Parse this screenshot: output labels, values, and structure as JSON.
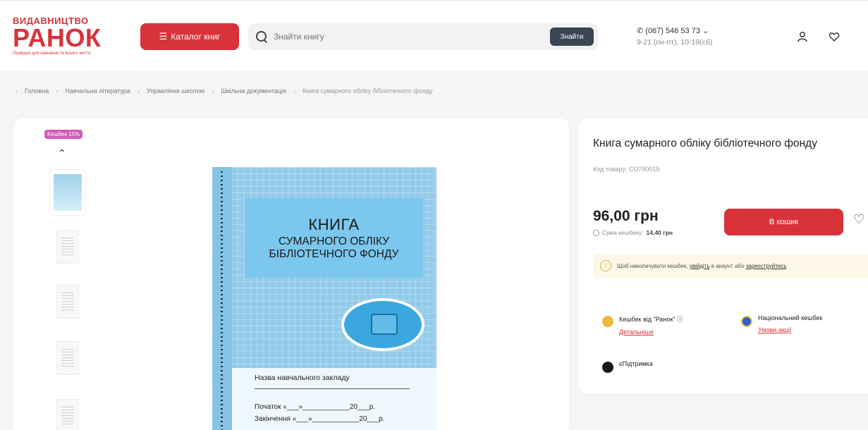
{
  "header": {
    "logo": {
      "top": "ВИДАВНИЦТВО",
      "main": "РАНОК",
      "sub": "Провідне для навчання та всього життя"
    },
    "catalog_label": "Каталог книг",
    "search": {
      "placeholder": "Знайти книгу",
      "button_label": "Знайти"
    },
    "phone": {
      "number": "(067) 546 53 73",
      "hours": "9-21 (пн-пт), 10-19(сб)"
    },
    "icons": [
      "user-icon",
      "heart-icon"
    ]
  },
  "breadcrumbs": [
    "Головна",
    "Навчальна література",
    "Управління школою",
    "Шкільна документація",
    "Книга сумарного обліку бібліотечного фонду"
  ],
  "gallery": {
    "badge": "Кешбек 15%",
    "cover": {
      "title1": "КНИГА",
      "title2": "СУМАРНОГО ОБЛІКУ",
      "title3": "БІБЛІОТЕЧНОГО ФОНДУ",
      "school_label": "Назва навчального закладу",
      "start_line": "Початок  «___»____________20___р.",
      "end_line": "Закінчення  «___»____________20___р."
    }
  },
  "product": {
    "name": "Книга сумарного обліку бібліотечного фонду",
    "code": "Код товару: СО780019",
    "price": "96,00 грн",
    "cashback_label": "Сума кешбеку:",
    "cashback_value": "14,40 грн",
    "buy_label": "В кошик",
    "notice_pre": "Щоб накопичувати кешбек, ",
    "notice_link1": "увійдіть",
    "notice_mid": " в акаунт або ",
    "notice_link2": "зареєструйтесь",
    "perks": [
      {
        "title": "Кешбек від \"Ранок\" ⓘ",
        "link": "Детальніше",
        "color": "#f2b83b"
      },
      {
        "title": "Національний кешбек",
        "link": "Умови акції",
        "color": "#2f5fd0"
      },
      {
        "title": "єПідтримка",
        "link": "",
        "color": "#1a1a1a"
      }
    ]
  },
  "colors": {
    "brand": "#d8333a",
    "search_button": "#3b4653",
    "badge": "#d05bb7"
  }
}
